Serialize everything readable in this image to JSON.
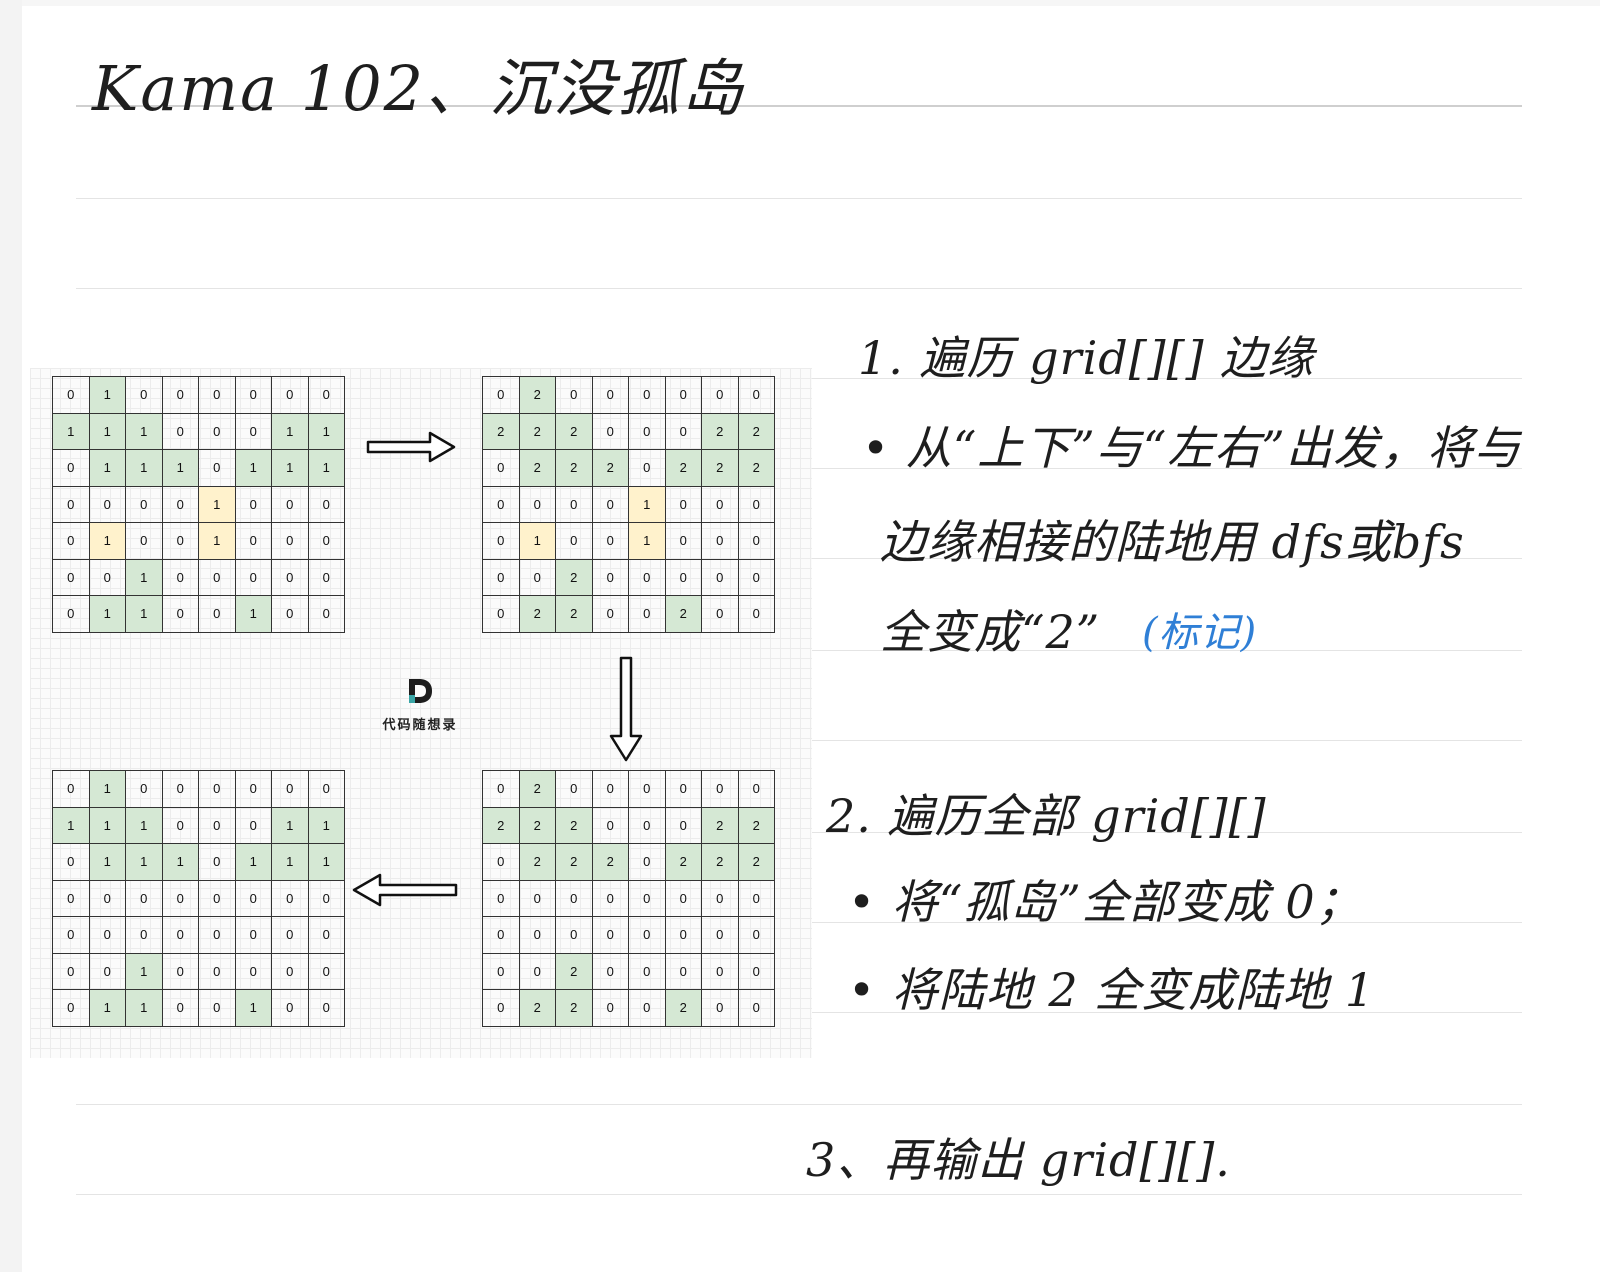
{
  "title": "Kama 102、沉没孤岛",
  "steps": [
    {
      "heading": "1. 遍历 grid[][] 边缘",
      "lines": [
        "• 从“上下”与“左右”出发，将与",
        "边缘相接的陆地用 dfs或bfs",
        "全变成“2”"
      ],
      "note": "(标记)"
    },
    {
      "heading": "2. 遍历全部 grid[][]",
      "lines": [
        "• 将“孤岛”全部变成 0；",
        "• 将陆地 2 全变成陆地 1"
      ]
    },
    {
      "heading": "3、再输出 grid[][]."
    }
  ],
  "logo": {
    "letter": "D",
    "text": "代码随想录"
  },
  "grids": [
    {
      "name": "grid-original",
      "values": [
        [
          0,
          1,
          0,
          0,
          0,
          0,
          0,
          0
        ],
        [
          1,
          1,
          1,
          0,
          0,
          0,
          1,
          1
        ],
        [
          0,
          1,
          1,
          1,
          0,
          1,
          1,
          1
        ],
        [
          0,
          0,
          0,
          0,
          1,
          0,
          0,
          0
        ],
        [
          0,
          1,
          0,
          0,
          1,
          0,
          0,
          0
        ],
        [
          0,
          0,
          1,
          0,
          0,
          0,
          0,
          0
        ],
        [
          0,
          1,
          1,
          0,
          0,
          1,
          0,
          0
        ]
      ]
    },
    {
      "name": "grid-marked",
      "values": [
        [
          0,
          2,
          0,
          0,
          0,
          0,
          0,
          0
        ],
        [
          2,
          2,
          2,
          0,
          0,
          0,
          2,
          2
        ],
        [
          0,
          2,
          2,
          2,
          0,
          2,
          2,
          2
        ],
        [
          0,
          0,
          0,
          0,
          1,
          0,
          0,
          0
        ],
        [
          0,
          1,
          0,
          0,
          1,
          0,
          0,
          0
        ],
        [
          0,
          0,
          2,
          0,
          0,
          0,
          0,
          0
        ],
        [
          0,
          2,
          2,
          0,
          0,
          2,
          0,
          0
        ]
      ]
    },
    {
      "name": "grid-sunk",
      "values": [
        [
          0,
          2,
          0,
          0,
          0,
          0,
          0,
          0
        ],
        [
          2,
          2,
          2,
          0,
          0,
          0,
          2,
          2
        ],
        [
          0,
          2,
          2,
          2,
          0,
          2,
          2,
          2
        ],
        [
          0,
          0,
          0,
          0,
          0,
          0,
          0,
          0
        ],
        [
          0,
          0,
          0,
          0,
          0,
          0,
          0,
          0
        ],
        [
          0,
          0,
          2,
          0,
          0,
          0,
          0,
          0
        ],
        [
          0,
          2,
          2,
          0,
          0,
          2,
          0,
          0
        ]
      ]
    },
    {
      "name": "grid-final",
      "values": [
        [
          0,
          1,
          0,
          0,
          0,
          0,
          0,
          0
        ],
        [
          1,
          1,
          1,
          0,
          0,
          0,
          1,
          1
        ],
        [
          0,
          1,
          1,
          1,
          0,
          1,
          1,
          1
        ],
        [
          0,
          0,
          0,
          0,
          0,
          0,
          0,
          0
        ],
        [
          0,
          0,
          0,
          0,
          0,
          0,
          0,
          0
        ],
        [
          0,
          0,
          1,
          0,
          0,
          0,
          0,
          0
        ],
        [
          0,
          1,
          1,
          0,
          0,
          1,
          0,
          0
        ]
      ]
    }
  ],
  "colors": {
    "land": "#d5e8d4",
    "island": "#fff2cc",
    "note": "#2f7fd6"
  }
}
